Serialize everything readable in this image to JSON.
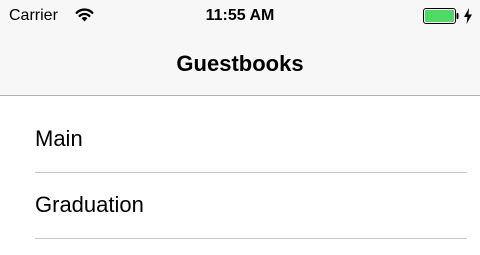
{
  "status_bar": {
    "carrier": "Carrier",
    "time": "11:55 AM",
    "wifi_icon": "wifi-icon",
    "battery_icon": "battery-icon",
    "battery_level": 1.0,
    "battery_color": "#4cd964",
    "charging_icon": "charging-bolt-icon"
  },
  "nav_bar": {
    "title": "Guestbooks"
  },
  "guestbooks": [
    {
      "label": "Main"
    },
    {
      "label": "Graduation"
    }
  ]
}
